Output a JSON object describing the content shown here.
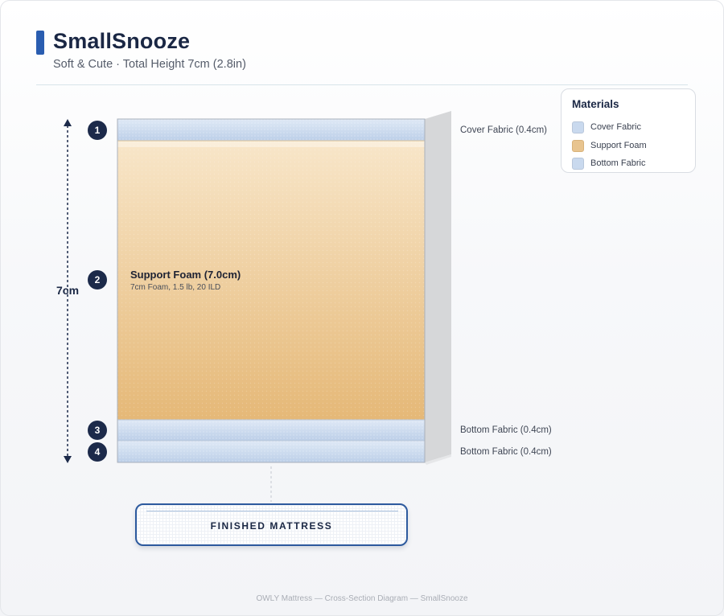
{
  "header": {
    "title": "SmallSnooze",
    "subtitle": "Soft & Cute · Total Height 7cm (2.8in)"
  },
  "legend": {
    "title": "Materials",
    "items": [
      {
        "label": "Cover Fabric",
        "color": "#c9d9ee"
      },
      {
        "label": "Support Foam",
        "color": "#e8c48f"
      },
      {
        "label": "Bottom Fabric",
        "color": "#c9d9ee"
      }
    ]
  },
  "diagram": {
    "height_label": "7cm",
    "layers": [
      {
        "number": "1",
        "side_label": "Cover Fabric (0.4cm)"
      },
      {
        "number": "2",
        "title": "Support Foam (7.0cm)",
        "description": "7cm Foam, 1.5 lb, 20 ILD"
      },
      {
        "number": "3",
        "side_label": "Bottom Fabric (0.4cm)"
      },
      {
        "number": "4",
        "side_label": "Bottom Fabric (0.4cm)"
      }
    ],
    "colors": {
      "fabric_light": "#d9e5f4",
      "fabric_dark": "#bccfe8",
      "foam_light": "#f7e3c4",
      "foam_dark": "#e5b877",
      "side_panel": "#d9d9da",
      "accent": "#2a5db0",
      "badge": "#1c2a4a"
    }
  },
  "result": {
    "label": "FINISHED MATTRESS"
  },
  "footer": {
    "text": "OWLY Mattress — Cross-Section Diagram — SmallSnooze"
  }
}
